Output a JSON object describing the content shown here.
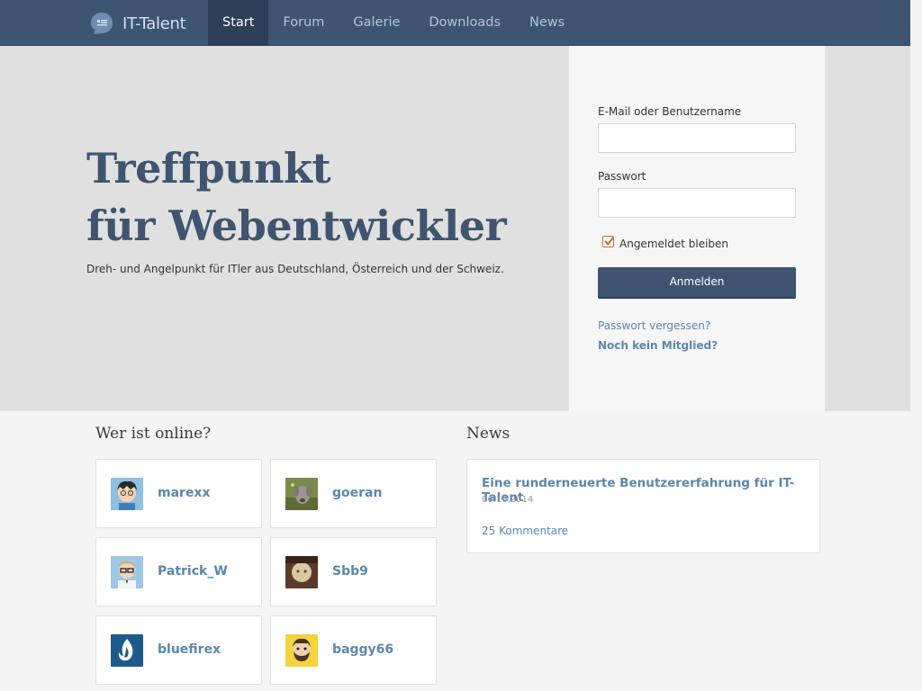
{
  "header": {
    "logo_text": "IT-Talent",
    "nav": [
      {
        "label": "Start",
        "active": true
      },
      {
        "label": "Forum"
      },
      {
        "label": "Galerie"
      },
      {
        "label": "Downloads"
      },
      {
        "label": "News"
      }
    ]
  },
  "hero": {
    "title_line1": "Treffpunkt",
    "title_line2": "für Webentwickler",
    "subtitle": "Dreh- und Angelpunkt für ITler aus Deutschland, Österreich und der Schweiz."
  },
  "login": {
    "user_label": "E-Mail oder Benutzername",
    "user_value": "",
    "password_label": "Passwort",
    "password_value": "",
    "remember_label": "Angemeldet bleiben",
    "remember_checked": true,
    "submit_label": "Anmelden",
    "forgot_link": "Passwort vergessen?",
    "register_link": "Noch kein Mitglied?"
  },
  "online": {
    "heading": "Wer ist online?",
    "users": [
      {
        "name": "marexx",
        "icon": "cartoon-avatar-icon"
      },
      {
        "name": "goeran",
        "icon": "dog-photo-avatar-icon"
      },
      {
        "name": "Patrick_W",
        "icon": "glasses-avatar-icon"
      },
      {
        "name": "Sbb9",
        "icon": "photo-avatar-icon"
      },
      {
        "name": "bluefirex",
        "icon": "flame-avatar-icon"
      },
      {
        "name": "baggy66",
        "icon": "bearded-avatar-icon"
      }
    ]
  },
  "news": {
    "heading": "News",
    "items": [
      {
        "title": "Eine runderneuerte Benutzererfahrung für IT-Talent",
        "date": "06.10.2014",
        "comments": "25 Kommentare"
      }
    ]
  },
  "colors": {
    "nav_bg": "#3e5571",
    "nav_active": "#2d4058",
    "accent_text": "#3f5470",
    "link": "#5b87ac",
    "hero_bg": "#dfe0df",
    "checkbox": "#c8703f"
  }
}
